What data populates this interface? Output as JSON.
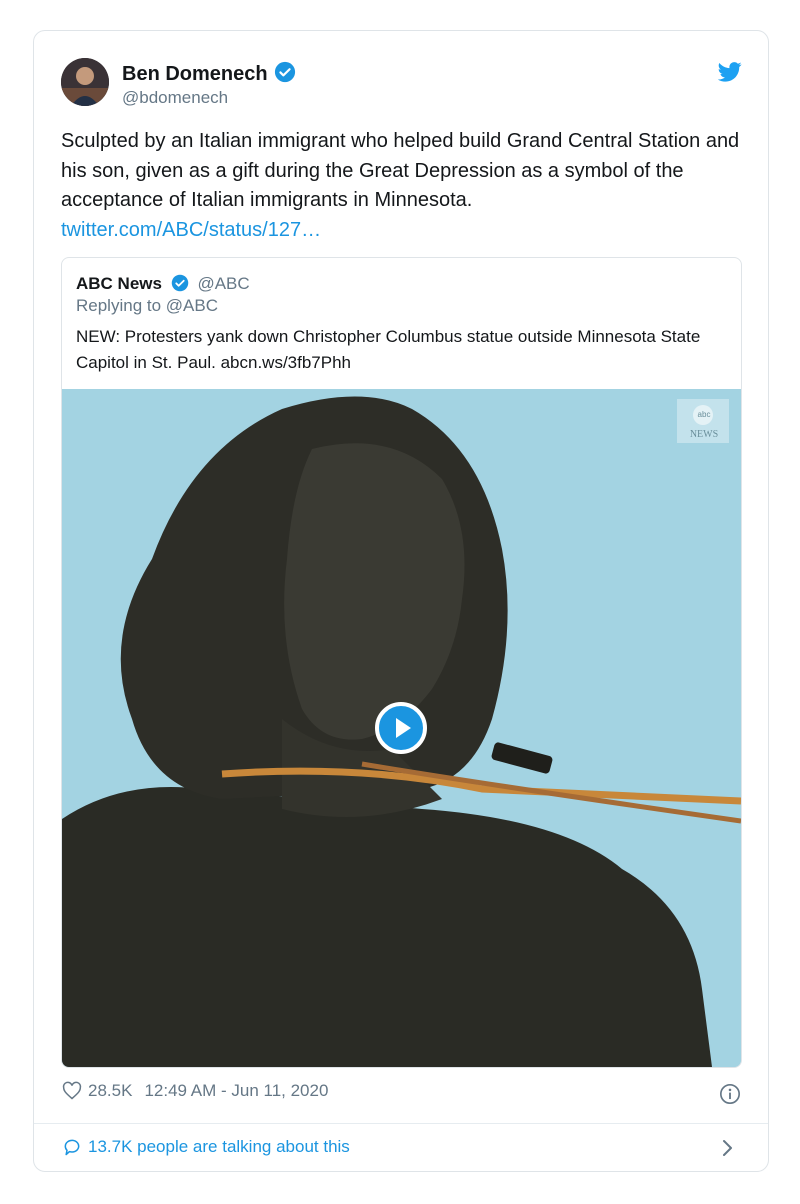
{
  "author": {
    "name": "Ben Domenech",
    "handle": "@bdomenech"
  },
  "tweet": {
    "text": "Sculpted by an Italian immigrant who helped build Grand Central Station and his son, given as a gift during the Great Depression as a symbol of the acceptance of Italian immigrants in Minnesota.",
    "link": "twitter.com/ABC/status/127…"
  },
  "quoted": {
    "name": "ABC News",
    "handle": "@ABC",
    "replying": "Replying to @ABC",
    "text": "NEW: Protesters yank down Christopher Columbus statue outside Minnesota State Capitol in St. Paul. abcn.ws/3fb7Phh",
    "watermark_top": "abc",
    "watermark_bottom": "NEWS"
  },
  "footer": {
    "likes": "28.5K",
    "timestamp": "12:49 AM - Jun 11, 2020"
  },
  "talk": {
    "label": "13.7K people are talking about this"
  },
  "colors": {
    "accent": "#1b95e0",
    "muted": "#657786",
    "border": "#dfe4e8",
    "sky": "#9fd1e0"
  },
  "icons": [
    "verified-icon",
    "twitter-bird-icon",
    "heart-icon",
    "info-icon",
    "comment-icon",
    "chevron-right-icon",
    "play-icon"
  ]
}
